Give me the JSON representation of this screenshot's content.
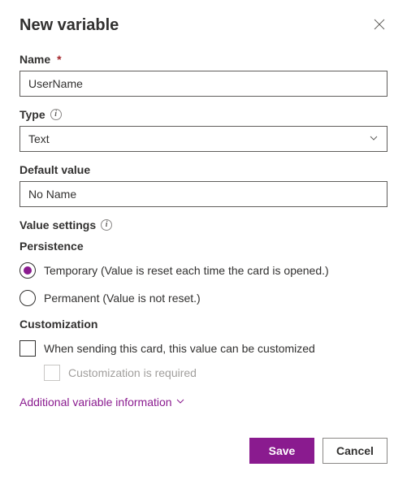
{
  "dialog": {
    "title": "New variable"
  },
  "name": {
    "label": "Name",
    "value": "UserName"
  },
  "type": {
    "label": "Type",
    "value": "Text"
  },
  "default_value": {
    "label": "Default value",
    "value": "No Name"
  },
  "value_settings": {
    "label": "Value settings"
  },
  "persistence": {
    "label": "Persistence",
    "temporary": "Temporary (Value is reset each time the card is opened.)",
    "permanent": "Permanent (Value is not reset.)"
  },
  "customization": {
    "label": "Customization",
    "option1": "When sending this card, this value can be customized",
    "option2": "Customization is required"
  },
  "additional": {
    "label": "Additional variable information"
  },
  "buttons": {
    "save": "Save",
    "cancel": "Cancel"
  }
}
